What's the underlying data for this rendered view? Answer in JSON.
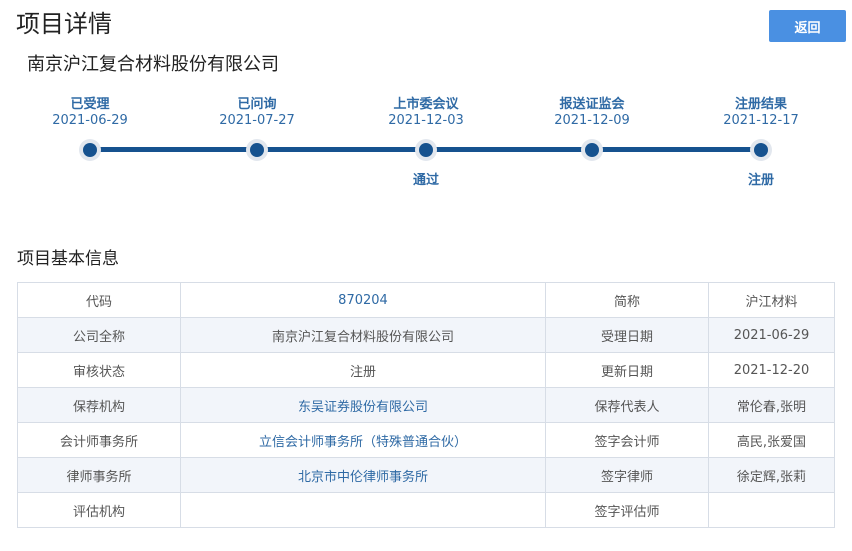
{
  "header": {
    "title": "项目详情",
    "back_label": "返回"
  },
  "company": {
    "name": "南京沪江复合材料股份有限公司"
  },
  "timeline": [
    {
      "label": "已受理",
      "date": "2021-06-29",
      "result": ""
    },
    {
      "label": "已问询",
      "date": "2021-07-27",
      "result": ""
    },
    {
      "label": "上市委会议",
      "date": "2021-12-03",
      "result": "通过"
    },
    {
      "label": "报送证监会",
      "date": "2021-12-09",
      "result": ""
    },
    {
      "label": "注册结果",
      "date": "2021-12-17",
      "result": "注册"
    }
  ],
  "basic_info": {
    "title": "项目基本信息",
    "rows": [
      {
        "k1": "代码",
        "v1": "870204",
        "k2": "简称",
        "v2": "沪江材料"
      },
      {
        "k1": "公司全称",
        "v1": "南京沪江复合材料股份有限公司",
        "k2": "受理日期",
        "v2": "2021-06-29"
      },
      {
        "k1": "审核状态",
        "v1": "注册",
        "k2": "更新日期",
        "v2": "2021-12-20"
      },
      {
        "k1": "保荐机构",
        "v1": "东吴证券股份有限公司",
        "k2": "保荐代表人",
        "v2": "常伦春,张明"
      },
      {
        "k1": "会计师事务所",
        "v1": "立信会计师事务所（特殊普通合伙）",
        "k2": "签字会计师",
        "v2": "高民,张爱国"
      },
      {
        "k1": "律师事务所",
        "v1": "北京市中伦律师事务所",
        "k2": "签字律师",
        "v2": "徐定辉,张莉"
      },
      {
        "k1": "评估机构",
        "v1": "",
        "k2": "签字评估师",
        "v2": ""
      }
    ]
  },
  "colors": {
    "accent": "#4a90e2",
    "timeline": "#16528f",
    "link": "#2f6aa5"
  }
}
